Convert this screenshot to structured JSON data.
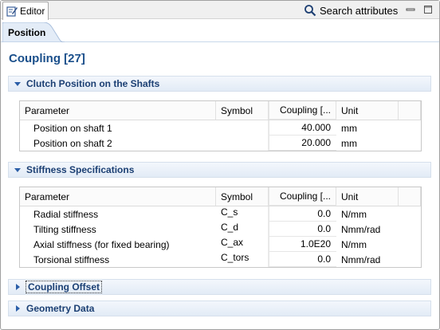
{
  "window": {
    "editor_tab_label": "Editor",
    "search_label": "Search attributes",
    "subtab_label": "Position"
  },
  "page": {
    "title": "Coupling [27]"
  },
  "sections": {
    "clutch": {
      "label": "Clutch Position on the Shafts",
      "expanded": true
    },
    "stiffness": {
      "label": "Stiffness Specifications",
      "expanded": true
    },
    "offset": {
      "label": "Coupling Offset",
      "expanded": false
    },
    "geometry": {
      "label": "Geometry Data",
      "expanded": false
    }
  },
  "table_headers": {
    "parameter": "Parameter",
    "symbol": "Symbol",
    "coupling": "Coupling [...",
    "unit": "Unit"
  },
  "clutch_rows": [
    {
      "parameter": "Position on shaft 1",
      "symbol": "",
      "value": "40.000",
      "unit": "mm"
    },
    {
      "parameter": "Position on shaft 2",
      "symbol": "",
      "value": "20.000",
      "unit": "mm"
    }
  ],
  "stiffness_rows": [
    {
      "parameter": "Radial stiffness",
      "symbol": "C_s",
      "value": "0.0",
      "unit": "N/mm"
    },
    {
      "parameter": "Tilting stiffness",
      "symbol": "C_d",
      "value": "0.0",
      "unit": "Nmm/rad"
    },
    {
      "parameter": "Axial stiffness (for fixed bearing)",
      "symbol": "C_ax",
      "value": "1.0E20",
      "unit": "N/mm"
    },
    {
      "parameter": "Torsional stiffness",
      "symbol": "C_tors",
      "value": "0.0",
      "unit": "Nmm/rad"
    }
  ],
  "colors": {
    "title": "#1a4f8b",
    "section_text": "#1b3f73",
    "section_bg": "#e2ebf6"
  },
  "icons": {
    "editor": "edit-note-icon",
    "search": "magnifier-icon",
    "minimize": "minimize-icon",
    "maximize": "maximize-icon",
    "expand": "triangle-down-icon",
    "collapse": "triangle-right-icon"
  }
}
